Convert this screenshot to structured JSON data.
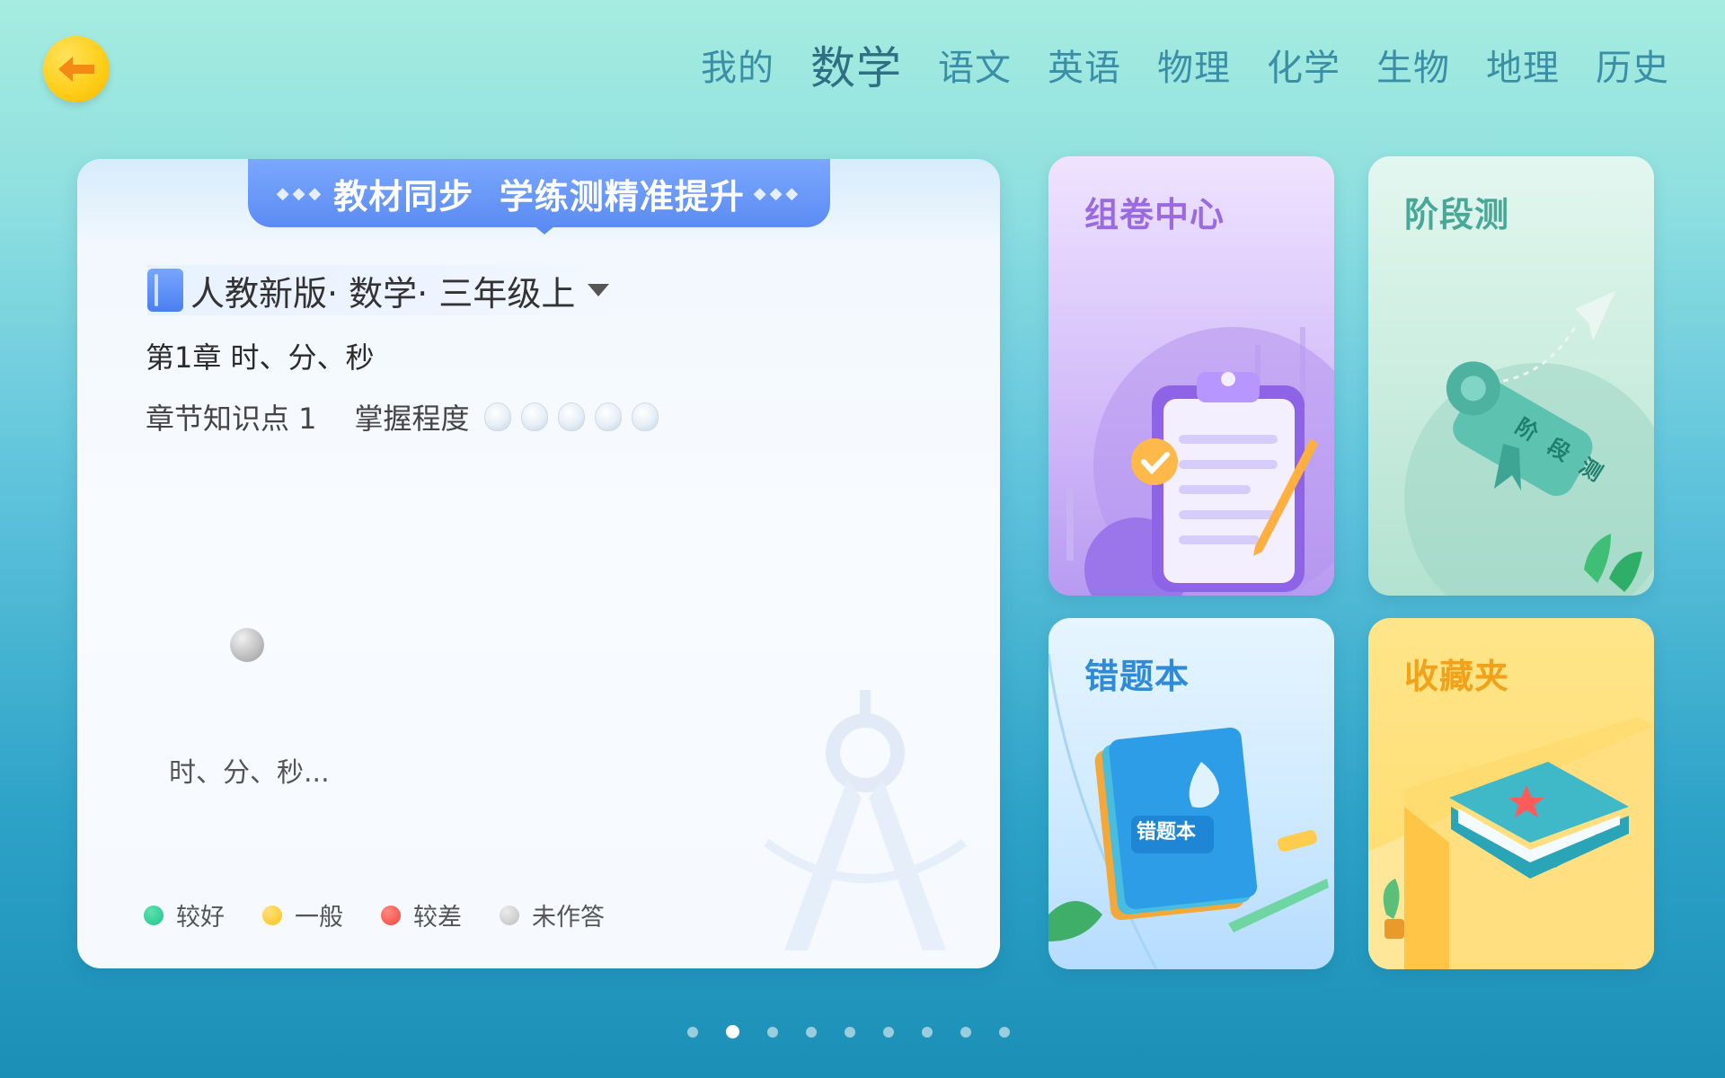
{
  "nav": {
    "items": [
      {
        "label": "我的",
        "active": false
      },
      {
        "label": "数学",
        "active": true
      },
      {
        "label": "语文",
        "active": false
      },
      {
        "label": "英语",
        "active": false
      },
      {
        "label": "物理",
        "active": false
      },
      {
        "label": "化学",
        "active": false
      },
      {
        "label": "生物",
        "active": false
      },
      {
        "label": "地理",
        "active": false
      },
      {
        "label": "历史",
        "active": false
      }
    ]
  },
  "main": {
    "banner": "教材同步  学练测精准提升",
    "book": "人教新版· 数学· 三年级上",
    "chapter": "第1章 时、分、秒",
    "knowledge_point": "章节知识点 1",
    "mastery_label": "掌握程度",
    "mastery_level": 0,
    "mastery_max": 5,
    "node_label": "时、分、秒...",
    "legend": [
      {
        "label": "较好",
        "color": "#1fc48b"
      },
      {
        "label": "一般",
        "color": "#ffc21a"
      },
      {
        "label": "较差",
        "color": "#f2453d"
      },
      {
        "label": "未作答",
        "color": "#bdbdbd"
      }
    ]
  },
  "tiles": {
    "paper_center": {
      "title": "组卷中心",
      "color": "#9a6be0"
    },
    "stage_test": {
      "title": "阶段测",
      "color": "#47a898",
      "scroll_text": "阶段测"
    },
    "wrong_book": {
      "title": "错题本",
      "color": "#2f8bd8",
      "book_text": "错题本"
    },
    "favorites": {
      "title": "收藏夹",
      "color": "#f2a21a"
    }
  },
  "pager": {
    "count": 9,
    "active": 1
  }
}
